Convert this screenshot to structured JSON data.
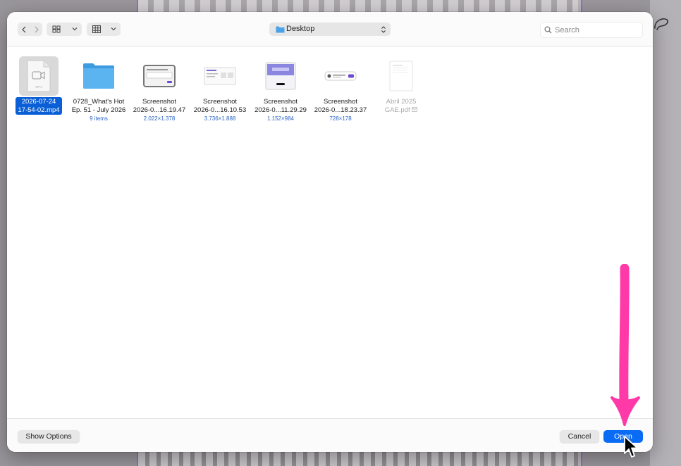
{
  "background": {
    "accent_color": "#8e6fd0"
  },
  "toolbar": {
    "back_icon": "chevron-left-icon",
    "forward_icon": "chevron-right-icon",
    "view_icon": "icon-grid-icon",
    "group_icon": "group-grid-icon",
    "location_label": "Desktop",
    "search_placeholder": "Search"
  },
  "files": [
    {
      "name_line1": "2026-07-24",
      "name_line2": "17-54-02.mp4",
      "meta": "",
      "kind": "video",
      "selected": true
    },
    {
      "name_line1": "0728_What's Hot",
      "name_line2": "Ep. 51 - July 2026",
      "meta": "9 items",
      "kind": "folder",
      "selected": false
    },
    {
      "name_line1": "Screenshot",
      "name_line2": "2026-0...16.19.47",
      "meta": "2.022×1.378",
      "kind": "screenshot",
      "selected": false
    },
    {
      "name_line1": "Screenshot",
      "name_line2": "2026-0...16.10.53",
      "meta": "3.736×1.888",
      "kind": "screenshot",
      "selected": false
    },
    {
      "name_line1": "Screenshot",
      "name_line2": "2026-0...11.29.29",
      "meta": "1.152×984",
      "kind": "screenshot",
      "selected": false
    },
    {
      "name_line1": "Screenshot",
      "name_line2": "2026-0...18.23.37",
      "meta": "728×178",
      "kind": "screenshot",
      "selected": false
    },
    {
      "name_line1": "Abril 2025",
      "name_line2": "GAE.pdf",
      "meta": "",
      "kind": "pdf",
      "selected": false
    }
  ],
  "footer": {
    "show_options_label": "Show Options",
    "cancel_label": "Cancel",
    "open_label": "Open"
  },
  "colors": {
    "primary_button": "#0a6cf5",
    "selection": "#0a5fd6",
    "annotation_arrow": "#ff3aa8"
  }
}
